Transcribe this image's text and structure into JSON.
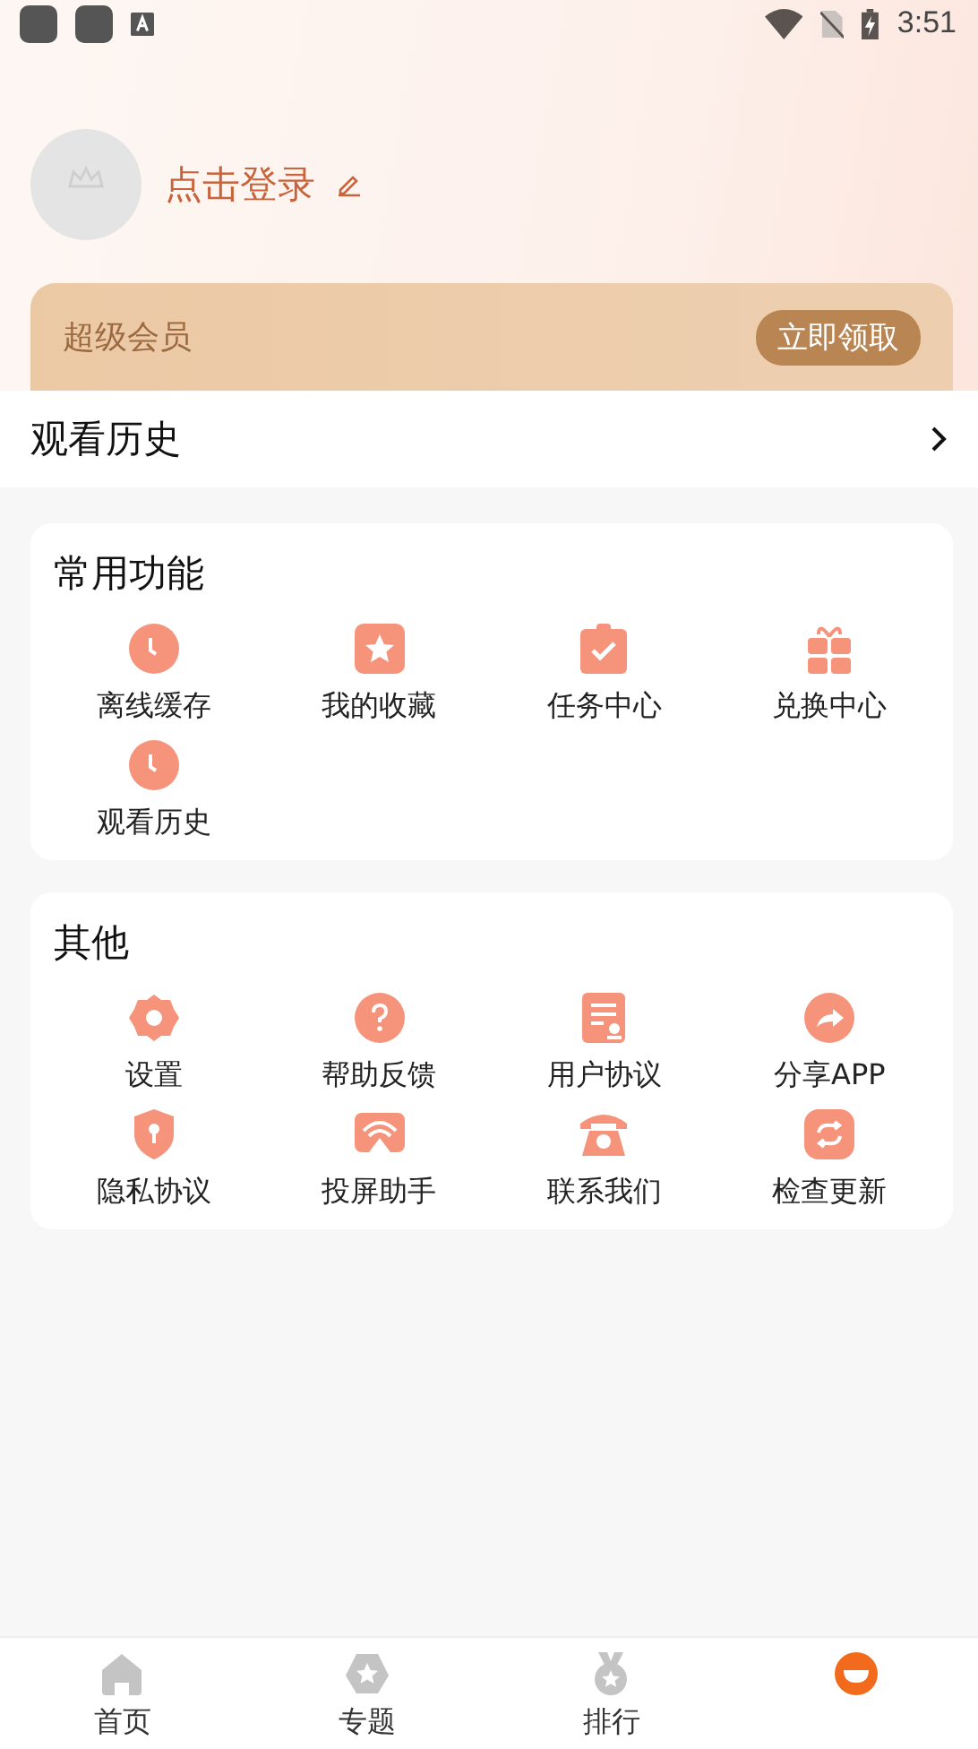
{
  "status_bar": {
    "time": "3:51"
  },
  "profile": {
    "login_label": "点击登录"
  },
  "vip_banner": {
    "title": "超级会员",
    "button": "立即领取"
  },
  "history_row": {
    "label": "观看历史"
  },
  "sections": [
    {
      "title": "常用功能",
      "items": [
        {
          "label": "离线缓存",
          "kind": "clock"
        },
        {
          "label": "我的收藏",
          "kind": "star"
        },
        {
          "label": "任务中心",
          "kind": "clipboard"
        },
        {
          "label": "兑换中心",
          "kind": "gift"
        },
        {
          "label": "观看历史",
          "kind": "clock"
        }
      ]
    },
    {
      "title": "其他",
      "items": [
        {
          "label": "设置",
          "kind": "gear"
        },
        {
          "label": "帮助反馈",
          "kind": "question"
        },
        {
          "label": "用户协议",
          "kind": "document"
        },
        {
          "label": "分享APP",
          "kind": "share"
        },
        {
          "label": "隐私协议",
          "kind": "shield"
        },
        {
          "label": "投屏助手",
          "kind": "cast"
        },
        {
          "label": "联系我们",
          "kind": "phone"
        },
        {
          "label": "检查更新",
          "kind": "refresh"
        }
      ]
    }
  ],
  "tab_bar": [
    {
      "label": "首页",
      "kind": "home",
      "selected": false
    },
    {
      "label": "专题",
      "kind": "badge",
      "selected": false
    },
    {
      "label": "排行",
      "kind": "medal",
      "selected": false
    },
    {
      "kind": "profile",
      "selected": true
    }
  ]
}
